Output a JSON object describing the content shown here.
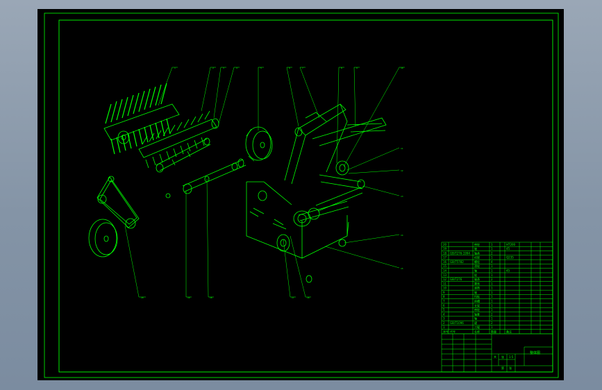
{
  "colors": {
    "background": "#8a9aac",
    "sheet": "#000000",
    "line": "#00ff00",
    "text": "#ffffff"
  },
  "balloons": [
    "1",
    "2",
    "3",
    "4",
    "5",
    "6",
    "7",
    "8",
    "9",
    "10",
    "11",
    "12",
    "13",
    "14",
    "15",
    "16",
    "17",
    "18",
    "19",
    "20"
  ],
  "title_block": {
    "drawing_title": "整体图",
    "scale": "1:5",
    "material": "",
    "sheet_marks": [
      "共",
      "张",
      "第",
      "张"
    ]
  },
  "parts_list": {
    "rows": [
      {
        "no": "20",
        "code": "",
        "name": "带轮",
        "qty": "1",
        "note": "HT200"
      },
      {
        "no": "19",
        "code": "",
        "name": "轴",
        "qty": "1",
        "note": "45"
      },
      {
        "no": "18",
        "code": "GB/T276-1994",
        "name": "轴承",
        "qty": "2",
        "note": ""
      },
      {
        "no": "17",
        "code": "",
        "name": "机架",
        "qty": "1",
        "note": "Q235"
      },
      {
        "no": "16",
        "code": "GB/T5782",
        "name": "螺栓",
        "qty": "4",
        "note": ""
      },
      {
        "no": "15",
        "code": "",
        "name": "滑轮",
        "qty": "1",
        "note": ""
      },
      {
        "no": "14",
        "code": "",
        "name": "轴",
        "qty": "1",
        "note": "45"
      },
      {
        "no": "13",
        "code": "",
        "name": "轮",
        "qty": "1",
        "note": ""
      },
      {
        "no": "12",
        "code": "GB/T276",
        "name": "轴承",
        "qty": "2",
        "note": ""
      },
      {
        "no": "11",
        "code": "",
        "name": "罩壳",
        "qty": "1",
        "note": ""
      },
      {
        "no": "10",
        "code": "",
        "name": "滚筒",
        "qty": "1",
        "note": ""
      },
      {
        "no": "9",
        "code": "",
        "name": "轴",
        "qty": "1",
        "note": ""
      },
      {
        "no": "8",
        "code": "",
        "name": "挡板",
        "qty": "1",
        "note": ""
      },
      {
        "no": "7",
        "code": "",
        "name": "斜槽",
        "qty": "1",
        "note": ""
      },
      {
        "no": "6",
        "code": "",
        "name": "支架",
        "qty": "1",
        "note": ""
      },
      {
        "no": "5",
        "code": "",
        "name": "带轮",
        "qty": "1",
        "note": ""
      },
      {
        "no": "4",
        "code": "",
        "name": "轴套",
        "qty": "2",
        "note": ""
      },
      {
        "no": "3",
        "code": "",
        "name": "轴",
        "qty": "1",
        "note": ""
      },
      {
        "no": "2",
        "code": "GB/T1096",
        "name": "键",
        "qty": "2",
        "note": ""
      },
      {
        "no": "1",
        "code": "",
        "name": "刀辊",
        "qty": "1",
        "note": ""
      }
    ],
    "header": [
      "序号",
      "代号",
      "名称",
      "数量",
      "备注"
    ]
  }
}
